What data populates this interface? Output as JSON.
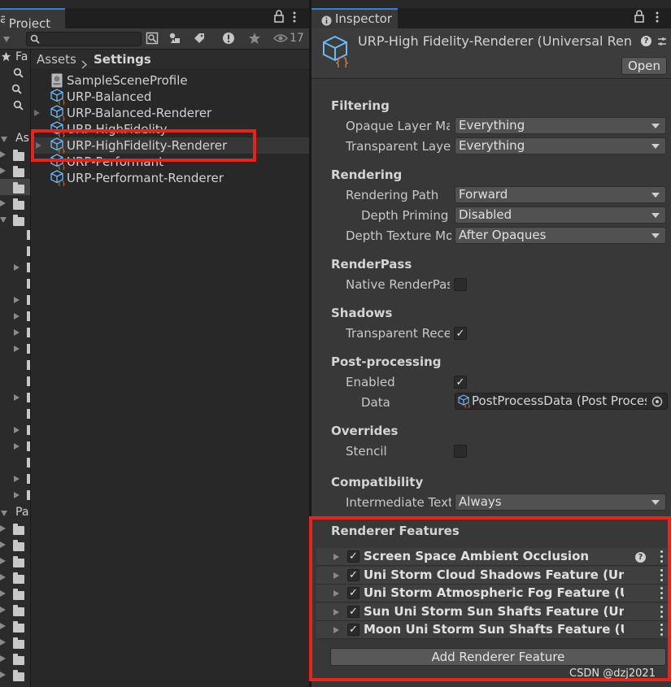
{
  "project": {
    "tab_label": "Project",
    "tab_prefix": "ą",
    "hidden_count": "17",
    "tree": {
      "favorites": "Fa",
      "assets": "As",
      "packages": "Pa"
    },
    "breadcrumb": {
      "root": "Assets",
      "current": "Settings"
    },
    "assets": [
      {
        "name": "SampleSceneProfile",
        "icon": "profile-icon"
      },
      {
        "name": "URP-Balanced",
        "icon": "urp-asset-icon"
      },
      {
        "name": "URP-Balanced-Renderer",
        "icon": "urp-asset-icon"
      },
      {
        "name": "URP-HighFidelity",
        "icon": "urp-asset-icon"
      },
      {
        "name": "URP-HighFidelity-Renderer",
        "icon": "urp-asset-icon"
      },
      {
        "name": "URP-Performant",
        "icon": "urp-asset-icon"
      },
      {
        "name": "URP-Performant-Renderer",
        "icon": "urp-asset-icon"
      }
    ]
  },
  "inspector": {
    "tab_label": "Inspector",
    "title": "URP-High Fidelity-Renderer (Universal Ren",
    "open_label": "Open",
    "sections": {
      "filtering": "Filtering",
      "rendering": "Rendering",
      "renderpass": "RenderPass",
      "shadows": "Shadows",
      "postprocessing": "Post-processing",
      "overrides": "Overrides",
      "compatibility": "Compatibility",
      "renderer_features": "Renderer Features"
    },
    "props": {
      "opaque_layer_mask": {
        "label": "Opaque Layer Ma",
        "value": "Everything"
      },
      "transparent_layer_mask": {
        "label": "Transparent Layer",
        "value": "Everything"
      },
      "rendering_path": {
        "label": "Rendering Path",
        "value": "Forward"
      },
      "depth_priming": {
        "label": "Depth Priming M",
        "value": "Disabled"
      },
      "depth_texture": {
        "label": "Depth Texture Mo",
        "value": "After Opaques"
      },
      "native_renderpass": {
        "label": "Native RenderPas",
        "checked": false
      },
      "transparent_receive": {
        "label": "Transparent Rece",
        "checked": true
      },
      "pp_enabled": {
        "label": "Enabled",
        "checked": true
      },
      "pp_data": {
        "label": "Data",
        "value": "PostProcessData (Post Proces"
      },
      "stencil": {
        "label": "Stencil",
        "checked": false
      },
      "intermediate_texture": {
        "label": "Intermediate Textu",
        "value": "Always"
      }
    },
    "features": [
      {
        "name": "Screen Space Ambient Occlusion",
        "enabled": true,
        "has_help": true
      },
      {
        "name": "Uni Storm Cloud Shadows Feature (Uni Stor",
        "enabled": true,
        "has_help": false
      },
      {
        "name": "Uni Storm Atmospheric Fog Feature (Uni St",
        "enabled": true,
        "has_help": false
      },
      {
        "name": "Sun Uni Storm Sun Shafts Feature (Uni Stor",
        "enabled": true,
        "has_help": false
      },
      {
        "name": "Moon Uni Storm Sun Shafts Feature (Uni St",
        "enabled": true,
        "has_help": false
      }
    ],
    "add_feature_label": "Add Renderer Feature"
  },
  "watermark": "CSDN @dzj2021",
  "colors": {
    "highlight": "#e8231a",
    "tab_accent": "#3a7bd5",
    "icon_blue": "#6fb8f0",
    "icon_orange": "#f07a3a"
  }
}
